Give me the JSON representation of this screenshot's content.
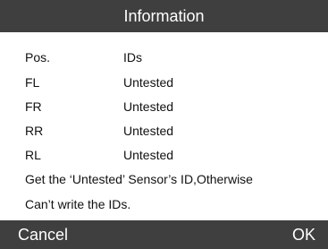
{
  "header": {
    "title": "Information"
  },
  "table": {
    "columns": [
      "Pos.",
      "IDs"
    ],
    "rows": [
      {
        "pos": "FL",
        "id": "Untested"
      },
      {
        "pos": "FR",
        "id": "Untested"
      },
      {
        "pos": "RR",
        "id": "Untested"
      },
      {
        "pos": "RL",
        "id": "Untested"
      }
    ]
  },
  "message": {
    "line1": "Get the ‘Untested’ Sensor’s ID,Otherwise",
    "line2": "Can’t write the IDs."
  },
  "footer": {
    "cancel_label": "Cancel",
    "ok_label": "OK"
  },
  "colors": {
    "bar": "#3f3f3f",
    "background": "#ffffff",
    "text": "#111111"
  }
}
